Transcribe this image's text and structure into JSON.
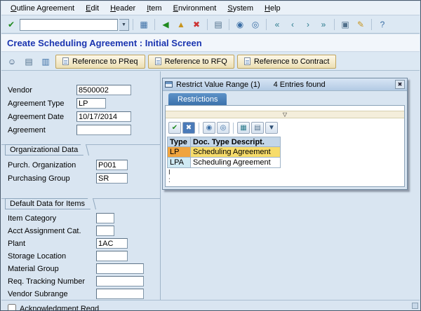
{
  "menu": {
    "items": [
      "Outline Agreement",
      "Edit",
      "Header",
      "Item",
      "Environment",
      "System",
      "Help"
    ]
  },
  "toolbar": {
    "command_value": ""
  },
  "header": {
    "title": "Create Scheduling Agreement : Initial Screen"
  },
  "app_toolbar": {
    "buttons": [
      {
        "label": "Reference to PReq"
      },
      {
        "label": "Reference to RFQ"
      },
      {
        "label": "Reference to Contract"
      }
    ]
  },
  "form": {
    "vendor": {
      "label": "Vendor",
      "value": "8500002"
    },
    "agreement_type": {
      "label": "Agreement Type",
      "value": "LP"
    },
    "agreement_date": {
      "label": "Agreement Date",
      "value": "10/17/2014"
    },
    "agreement": {
      "label": "Agreement",
      "value": ""
    },
    "org": {
      "title": "Organizational Data",
      "purch_org": {
        "label": "Purch. Organization",
        "value": "P001"
      },
      "purch_group": {
        "label": "Purchasing Group",
        "value": "SR"
      }
    },
    "defaults": {
      "title": "Default Data for Items",
      "item_category": {
        "label": "Item Category",
        "value": ""
      },
      "acct_assignment": {
        "label": "Acct Assignment Cat.",
        "value": ""
      },
      "plant": {
        "label": "Plant",
        "value": "1AC"
      },
      "storage_location": {
        "label": "Storage Location",
        "value": ""
      },
      "material_group": {
        "label": "Material Group",
        "value": ""
      },
      "req_tracking": {
        "label": "Req. Tracking Number",
        "value": ""
      },
      "vendor_subrange": {
        "label": "Vendor Subrange",
        "value": ""
      },
      "acknowledgment": {
        "label": "Acknowledgment Reqd",
        "checked": false
      }
    }
  },
  "popup": {
    "title": "Restrict Value Range (1)",
    "entries": "4 Entries found",
    "tab": "Restrictions",
    "grid": {
      "headers": [
        "Type",
        "Doc. Type Descript."
      ],
      "rows": [
        {
          "type": "LP",
          "desc": "Scheduling Agreement",
          "selected": true
        },
        {
          "type": "LPA",
          "desc": "Scheduling Agreement",
          "selected": false
        }
      ]
    },
    "artifacts": {
      "cursor": "I",
      "dots": ":"
    }
  },
  "icons": {
    "enter": "✔",
    "dropdown": "▼",
    "save": "▦",
    "back": "◀",
    "exit": "▲",
    "cancel": "✖",
    "print": "▤",
    "find": "◉",
    "find_next": "◎",
    "first_page": "«",
    "prev_page": "‹",
    "next_page": "›",
    "last_page": "»",
    "new_session": "▣",
    "shortcut": "✎",
    "help": "?",
    "person": "☺",
    "copy": "▥",
    "filter": "▽",
    "export": "▦"
  },
  "colors": {
    "title_text": "#1b35b0",
    "tab_active": "#3c72ac",
    "selected_row_key": "#f0a43e",
    "selected_row_value": "#f7dc6a",
    "alt_key_cell": "#cfe9f3",
    "button_face": "#f3e6bc"
  }
}
